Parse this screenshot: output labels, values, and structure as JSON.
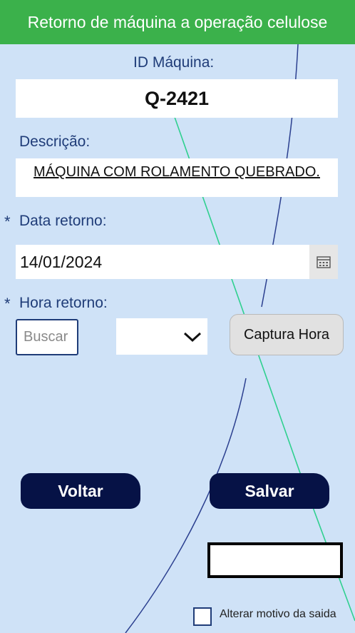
{
  "header": {
    "title": "Retorno de máquina a operação celulose"
  },
  "fields": {
    "id_label": "ID Máquina:",
    "id_value": "Q-2421",
    "desc_label": "Descrição:",
    "desc_value": "MÁQUINA COM ROLAMENTO QUEBRADO.",
    "required_mark": "*",
    "date_label": "Data retorno:",
    "date_value": "14/01/2024",
    "time_label": "Hora retorno:",
    "search_placeholder": "Buscar",
    "capture_button": "Captura Hora"
  },
  "actions": {
    "back_label": "Voltar",
    "save_label": "Salvar"
  },
  "footer": {
    "checkbox_label": "Alterar motivo da saida"
  },
  "colors": {
    "header_bg": "#3bb14b",
    "page_bg": "#cfe2f7",
    "button_bg": "#061246",
    "label_text": "#1f3c78"
  },
  "icons": {
    "calendar": "calendar-icon",
    "dropdown": "chevron-down-icon"
  }
}
